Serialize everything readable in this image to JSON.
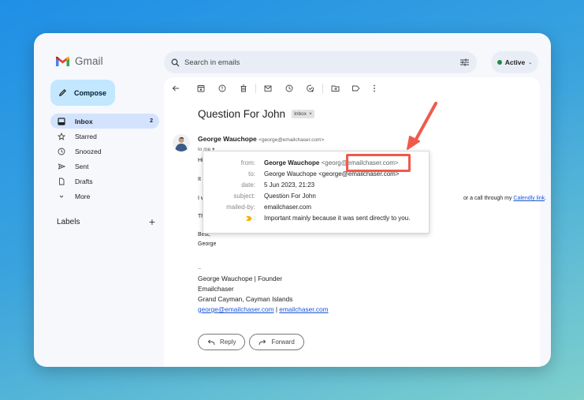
{
  "app": {
    "name": "Gmail",
    "brand_colors": {
      "red": "#ea4335",
      "blue": "#4285f4",
      "green": "#34a853",
      "yellow": "#fbbc04"
    }
  },
  "compose": {
    "label": "Compose",
    "icon": "pencil-icon"
  },
  "sidebar": {
    "items": [
      {
        "label": "Inbox",
        "icon": "inbox-icon",
        "count": "2",
        "active": true
      },
      {
        "label": "Starred",
        "icon": "star-icon"
      },
      {
        "label": "Snoozed",
        "icon": "clock-icon"
      },
      {
        "label": "Sent",
        "icon": "send-icon"
      },
      {
        "label": "Drafts",
        "icon": "draft-icon"
      },
      {
        "label": "More",
        "icon": "chevron-down-icon"
      }
    ],
    "labels_heading": "Labels",
    "add_label_icon": "plus-icon"
  },
  "search": {
    "placeholder": "Search in emails",
    "icon": "search-icon",
    "filter_icon": "tune-icon"
  },
  "status": {
    "label": "Active",
    "color": "#1e8e3e"
  },
  "toolbar": {
    "buttons": [
      "back-arrow-icon",
      "archive-icon",
      "report-spam-icon",
      "delete-icon",
      "mark-unread-icon",
      "snooze-icon",
      "add-task-icon",
      "move-to-icon",
      "label-icon",
      "more-vert-icon"
    ]
  },
  "email": {
    "subject": "Question For John",
    "label_badge": "Inbox",
    "label_badge_close": "×",
    "sender_name": "George Wauchope",
    "sender_email": "<george@emailchaser.com>",
    "to_me": "to me",
    "body_lines": [
      "Hi Joh",
      "It was",
      "I want",
      "This is",
      "Best,",
      "George"
    ],
    "body_call_suffix": "or a call through my ",
    "calendly_link": "Calendly link",
    "calendly_period": ".",
    "signature": {
      "separator": "--",
      "name_title": "George Wauchope | Founder",
      "company": "Emailchaser",
      "location": "Grand Cayman, Cayman Islands",
      "email_link": "george@emailchaser.com",
      "divider": " | ",
      "site_link": "emailchaser.com"
    },
    "reply_label": "Reply",
    "forward_label": "Forward"
  },
  "details_popup": {
    "rows": [
      {
        "key": "from:",
        "name": "George Wauchope",
        "value": " <george@emailchaser.com>"
      },
      {
        "key": "to:",
        "value": "George Wauchope <george@emailchaser.com>"
      },
      {
        "key": "date:",
        "value": "5 Jun 2023, 21:23"
      },
      {
        "key": "subject:",
        "value": "Question For John"
      },
      {
        "key": "mailed-by:",
        "value": "emailchaser.com"
      },
      {
        "key": ":",
        "value": "Important mainly because it was sent directly to you.",
        "icon": "importance-marker-icon"
      }
    ],
    "from_addr_visible_prefix": " <georg",
    "from_addr_highlighted": "@emailchaser.com>"
  },
  "annotation": {
    "color": "#ef5a4c",
    "highlight_target": "sender domain @emailchaser.com"
  }
}
